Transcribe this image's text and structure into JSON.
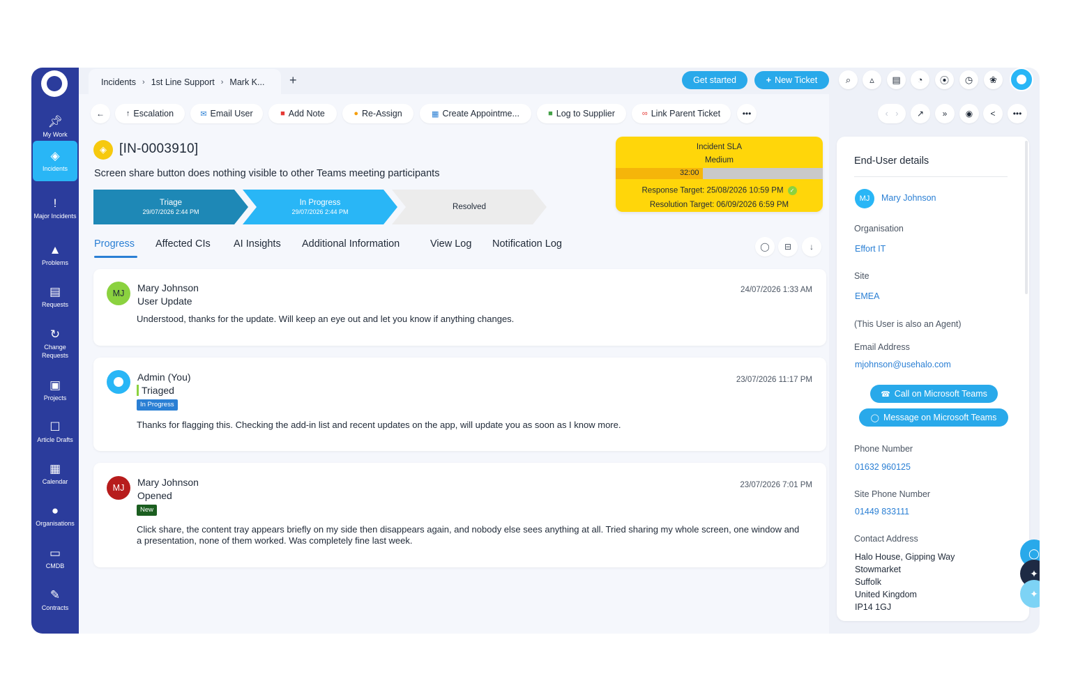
{
  "sidebar": {
    "items": [
      {
        "label": "My Work",
        "icon": "pin-icon"
      },
      {
        "label": "Incidents",
        "icon": "ticket-icon"
      },
      {
        "label": "Major Incidents",
        "icon": "exclamation-icon"
      },
      {
        "label": "Problems",
        "icon": "warning-icon"
      },
      {
        "label": "Requests",
        "icon": "cart-icon"
      },
      {
        "label": "Change Requests",
        "icon": "refresh-icon"
      },
      {
        "label": "Projects",
        "icon": "briefcase-icon"
      },
      {
        "label": "Article Drafts",
        "icon": "bookmark-icon"
      },
      {
        "label": "Calendar",
        "icon": "calendar-icon"
      },
      {
        "label": "Organisations",
        "icon": "person-icon"
      },
      {
        "label": "CMDB",
        "icon": "laptop-icon"
      },
      {
        "label": "Contracts",
        "icon": "edit-icon"
      }
    ]
  },
  "breadcrumb": {
    "items": [
      "Incidents",
      "1st Line Support",
      "Mark K..."
    ],
    "plus": "+"
  },
  "header": {
    "get_started": "Get started",
    "new_ticket": "New Ticket"
  },
  "actions": {
    "escalation": "Escalation",
    "email_user": "Email User",
    "add_note": "Add Note",
    "re_assign": "Re-Assign",
    "create_appointment": "Create Appointme...",
    "log_to_supplier": "Log to Supplier",
    "link_parent": "Link Parent Ticket",
    "more": "•••"
  },
  "ticket": {
    "id": "[IN-0003910]",
    "summary": "Screen share button does nothing visible to other Teams meeting participants"
  },
  "stages": [
    {
      "name": "Triage",
      "date": "29/07/2026 2:44 PM",
      "color": "#1e88b6"
    },
    {
      "name": "In Progress",
      "date": "29/07/2026 2:44 PM",
      "color": "#29b6f6"
    },
    {
      "name": "Resolved",
      "date": "",
      "color": "#ececec"
    }
  ],
  "sla": {
    "title": "Incident SLA",
    "priority": "Medium",
    "time": "32:00",
    "progress": 0.42,
    "response": "Response Target: 25/08/2026 10:59 PM",
    "resolution": "Resolution Target: 06/09/2026 6:59 PM"
  },
  "tabs": [
    "Progress",
    "Affected CIs",
    "AI Insights",
    "Additional Information",
    "View Log",
    "Notification Log"
  ],
  "timeline": [
    {
      "initials": "MJ",
      "name": "Mary Johnson",
      "action": "User Update",
      "time": "24/07/2026 1:33 AM",
      "badge": "",
      "message": "Understood, thanks for the update. Will keep an eye out and let you know if anything changes.",
      "avatar_color": "#8bd23f"
    },
    {
      "initials": "",
      "name": "Admin (You)",
      "action": "Triaged",
      "time": "23/07/2026 11:17 PM",
      "badge": "In Progress",
      "message": "Thanks for flagging this. Checking the add-in list and recent updates on the app, will update you as soon as I know more.",
      "avatar_color": "#29b6f6"
    },
    {
      "initials": "MJ",
      "name": "Mary Johnson",
      "action": "Opened",
      "time": "23/07/2026 7:01 PM",
      "badge": "New",
      "message": "Click share, the content tray appears briefly on my side then disappears again, and nobody else sees anything at all. Tried sharing my whole screen, one window and a presentation, none of them worked. Was completely fine last week.",
      "avatar_color": "#b71c1c"
    }
  ],
  "end_user": {
    "title": "End-User details",
    "initials": "MJ",
    "name": "Mary Johnson",
    "org_label": "Organisation",
    "org": "Effort IT",
    "site_label": "Site",
    "site": "EMEA",
    "agent_note": "(This User is also an Agent)",
    "email_label": "Email Address",
    "email": "mjohnson@usehalo.com",
    "call_btn": "Call on Microsoft Teams",
    "msg_btn": "Message on Microsoft Teams",
    "phone_label": "Phone Number",
    "phone": "01632 960125",
    "site_phone_label": "Site Phone Number",
    "site_phone": "01449 833111",
    "address_label": "Contact Address",
    "address": [
      "Halo House, Gipping Way",
      "Stowmarket",
      "Suffolk",
      "United Kingdom",
      "IP14 1GJ"
    ]
  },
  "colors": {
    "sidebar": "#2b3c9c",
    "accent": "#29a9ea",
    "sla": "#ffd60a",
    "link": "#2a7fd4"
  }
}
